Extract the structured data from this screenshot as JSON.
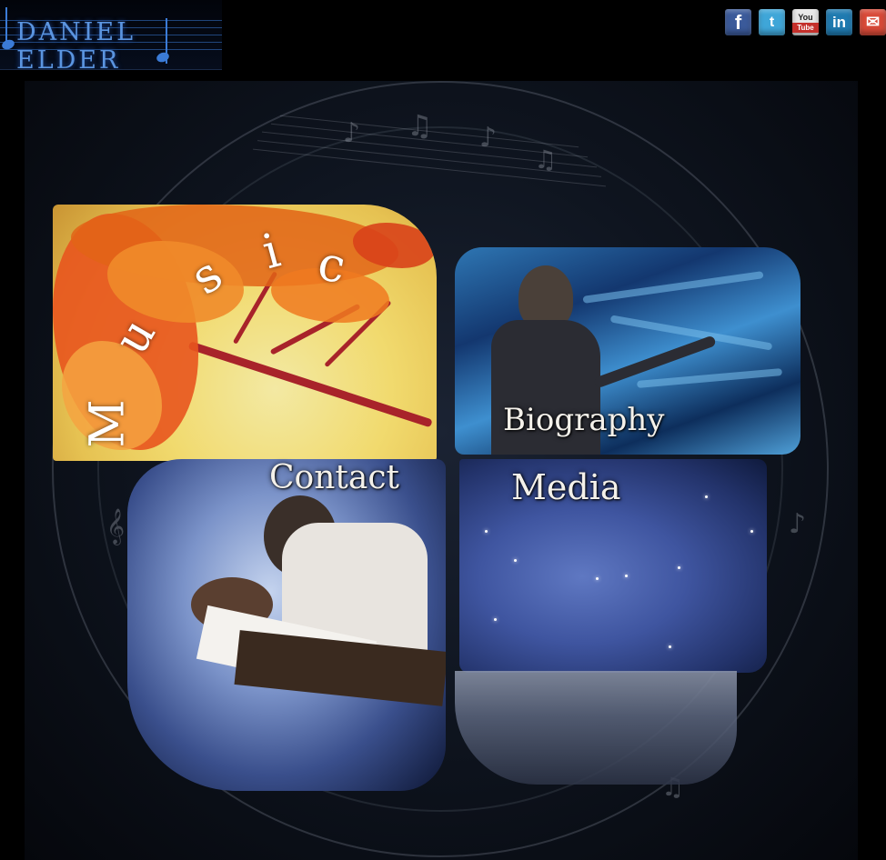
{
  "header": {
    "logo_text": "DANIEL ELDER"
  },
  "social": [
    {
      "name": "facebook-icon",
      "glyph": "f"
    },
    {
      "name": "twitter-icon",
      "glyph": "t"
    },
    {
      "name": "youtube-icon",
      "glyph_top": "You",
      "glyph_bottom": "Tube"
    },
    {
      "name": "linkedin-icon",
      "glyph": "in"
    },
    {
      "name": "email-icon",
      "glyph": "✉"
    }
  ],
  "nav": {
    "music": [
      "M",
      "u",
      "s",
      "i",
      "c"
    ],
    "biography": "Biography",
    "contact": "Contact",
    "media": "Media"
  },
  "colors": {
    "background": "#000000",
    "logo_blue": "#5b95e0",
    "label_text": "#f4f1ea",
    "music_leaves": "#e8551e",
    "music_branch": "#a8232a"
  }
}
